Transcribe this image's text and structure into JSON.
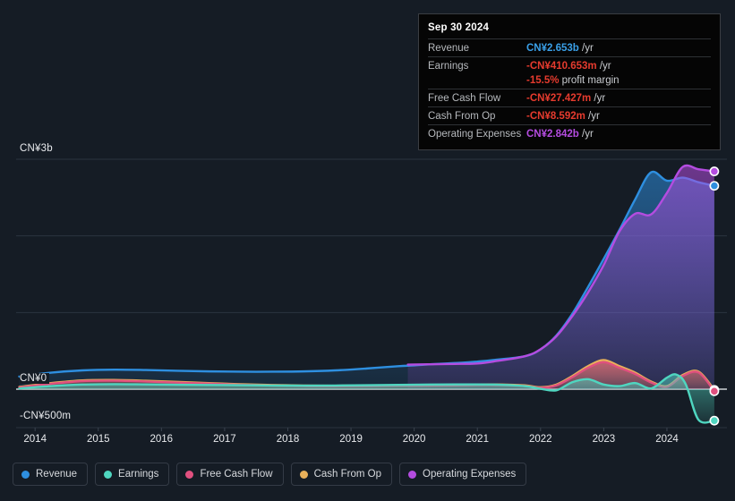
{
  "background_color": "#151c25",
  "tooltip": {
    "date": "Sep 30 2024",
    "rows": [
      {
        "label": "Revenue",
        "value": "CN¥2.653b",
        "unit": "/yr",
        "color": "#3aa0e8"
      },
      {
        "label": "Earnings",
        "value": "-CN¥410.653m",
        "unit": "/yr",
        "color": "#e63b2e"
      },
      {
        "label": "",
        "value": "-15.5%",
        "unit": "profit margin",
        "color": "#e63b2e",
        "sub": true
      },
      {
        "label": "Free Cash Flow",
        "value": "-CN¥27.427m",
        "unit": "/yr",
        "color": "#e63b2e"
      },
      {
        "label": "Cash From Op",
        "value": "-CN¥8.592m",
        "unit": "/yr",
        "color": "#e63b2e"
      },
      {
        "label": "Operating Expenses",
        "value": "CN¥2.842b",
        "unit": "/yr",
        "color": "#b44ce0"
      }
    ]
  },
  "legend": {
    "items": [
      {
        "label": "Revenue",
        "color": "#2e8fe0"
      },
      {
        "label": "Earnings",
        "color": "#4fd6c0"
      },
      {
        "label": "Free Cash Flow",
        "color": "#e0507f"
      },
      {
        "label": "Cash From Op",
        "color": "#e8b05a"
      },
      {
        "label": "Operating Expenses",
        "color": "#b44ce0"
      }
    ]
  },
  "chart_data": {
    "type": "area",
    "title": "",
    "xlabel": "",
    "ylabel": "",
    "currency": "CN¥",
    "ylim": [
      -500000000,
      3000000000
    ],
    "y_ticks": [
      {
        "label": "CN¥3b",
        "value": 3000000000
      },
      {
        "label": "CN¥0",
        "value": 0
      },
      {
        "label": "-CN¥500m",
        "value": -500000000
      }
    ],
    "gridlines": [
      3000000000,
      2000000000,
      1000000000,
      0
    ],
    "zero_line": 0,
    "x_ticks": [
      "2014",
      "2015",
      "2016",
      "2017",
      "2018",
      "2019",
      "2020",
      "2021",
      "2022",
      "2023",
      "2024"
    ],
    "x_range": [
      2013.7,
      2024.95
    ],
    "legend_position": "bottom",
    "grid": true,
    "series": [
      {
        "name": "Revenue",
        "color": "#2e8fe0",
        "fill": "rgba(46,143,224,0.30)",
        "x": [
          2013.75,
          2014.25,
          2014.75,
          2015.25,
          2015.75,
          2016.25,
          2016.75,
          2017.25,
          2017.75,
          2018.25,
          2018.75,
          2019.25,
          2019.75,
          2020.0,
          2020.25,
          2020.75,
          2021.0,
          2021.25,
          2021.75,
          2022.0,
          2022.25,
          2022.5,
          2022.75,
          2023.0,
          2023.25,
          2023.5,
          2023.75,
          2024.0,
          2024.25,
          2024.5,
          2024.75
        ],
        "values": [
          0.165,
          0.215,
          0.245,
          0.255,
          0.25,
          0.24,
          0.232,
          0.228,
          0.228,
          0.232,
          0.245,
          0.27,
          0.3,
          0.31,
          0.325,
          0.345,
          0.36,
          0.38,
          0.43,
          0.52,
          0.7,
          0.98,
          1.33,
          1.7,
          2.08,
          2.48,
          2.83,
          2.72,
          2.76,
          2.7,
          2.653
        ],
        "endpoint_value": 2.653,
        "endpoint_marker": true
      },
      {
        "name": "Operating Expenses",
        "color": "#b44ce0",
        "fill": "rgba(180,76,224,0.30)",
        "x": [
          2019.9,
          2020.25,
          2020.75,
          2021.0,
          2021.25,
          2021.75,
          2022.0,
          2022.25,
          2022.5,
          2022.75,
          2023.0,
          2023.25,
          2023.5,
          2023.75,
          2024.0,
          2024.25,
          2024.5,
          2024.75
        ],
        "values": [
          0.32,
          0.325,
          0.33,
          0.335,
          0.36,
          0.43,
          0.52,
          0.69,
          0.95,
          1.26,
          1.62,
          2.06,
          2.29,
          2.28,
          2.56,
          2.9,
          2.87,
          2.842
        ],
        "endpoint_value": 2.842,
        "endpoint_marker": true
      },
      {
        "name": "Cash From Op",
        "color": "#e8b05a",
        "fill": "rgba(232,176,90,0.32)",
        "x": [
          2013.75,
          2014.25,
          2014.75,
          2015.25,
          2015.75,
          2016.25,
          2016.75,
          2017.25,
          2017.75,
          2018.25,
          2018.75,
          2019.25,
          2019.75,
          2020.25,
          2020.75,
          2021.25,
          2021.75,
          2022.0,
          2022.25,
          2022.5,
          2022.75,
          2023.0,
          2023.25,
          2023.5,
          2023.75,
          2024.0,
          2024.25,
          2024.5,
          2024.75
        ],
        "values": [
          0.03,
          0.08,
          0.115,
          0.12,
          0.11,
          0.095,
          0.08,
          0.065,
          0.055,
          0.048,
          0.045,
          0.048,
          0.052,
          0.055,
          0.058,
          0.062,
          0.05,
          0.025,
          0.06,
          0.17,
          0.3,
          0.38,
          0.3,
          0.215,
          0.1,
          0.04,
          0.185,
          0.23,
          -0.0086
        ],
        "endpoint_value": -0.0086,
        "endpoint_marker": true
      },
      {
        "name": "Free Cash Flow",
        "color": "#e0507f",
        "fill": "rgba(224,80,127,0.30)",
        "x": [
          2013.75,
          2014.25,
          2014.75,
          2015.25,
          2015.75,
          2016.25,
          2016.75,
          2017.25,
          2017.75,
          2018.25,
          2018.75,
          2019.25,
          2019.75,
          2020.25,
          2020.75,
          2021.25,
          2021.75,
          2022.0,
          2022.25,
          2022.5,
          2022.75,
          2023.0,
          2023.25,
          2023.5,
          2023.75,
          2024.0,
          2024.25,
          2024.5,
          2024.75
        ],
        "values": [
          0.022,
          0.07,
          0.105,
          0.11,
          0.1,
          0.085,
          0.072,
          0.058,
          0.048,
          0.04,
          0.038,
          0.04,
          0.044,
          0.046,
          0.05,
          0.054,
          0.042,
          0.018,
          0.05,
          0.155,
          0.278,
          0.352,
          0.278,
          0.198,
          0.088,
          0.03,
          0.172,
          0.218,
          -0.0274
        ],
        "endpoint_value": -0.0274,
        "endpoint_marker": true
      },
      {
        "name": "Earnings",
        "color": "#4fd6c0",
        "fill": "rgba(79,214,192,0.28)",
        "x": [
          2013.75,
          2014.25,
          2014.75,
          2015.25,
          2015.75,
          2016.25,
          2016.75,
          2017.25,
          2017.75,
          2018.25,
          2018.75,
          2019.25,
          2019.75,
          2020.25,
          2020.75,
          2021.25,
          2021.75,
          2022.0,
          2022.25,
          2022.5,
          2022.75,
          2023.0,
          2023.25,
          2023.5,
          2023.75,
          2024.0,
          2024.15,
          2024.3,
          2024.5,
          2024.75
        ],
        "values": [
          0.01,
          0.04,
          0.06,
          0.065,
          0.062,
          0.058,
          0.055,
          0.052,
          0.048,
          0.046,
          0.048,
          0.052,
          0.056,
          0.06,
          0.062,
          0.06,
          0.04,
          0.005,
          -0.015,
          0.09,
          0.13,
          0.06,
          0.04,
          0.08,
          0.01,
          0.15,
          0.19,
          0.06,
          -0.4,
          -0.4107
        ],
        "endpoint_value": -0.4107,
        "endpoint_marker": true
      }
    ]
  }
}
